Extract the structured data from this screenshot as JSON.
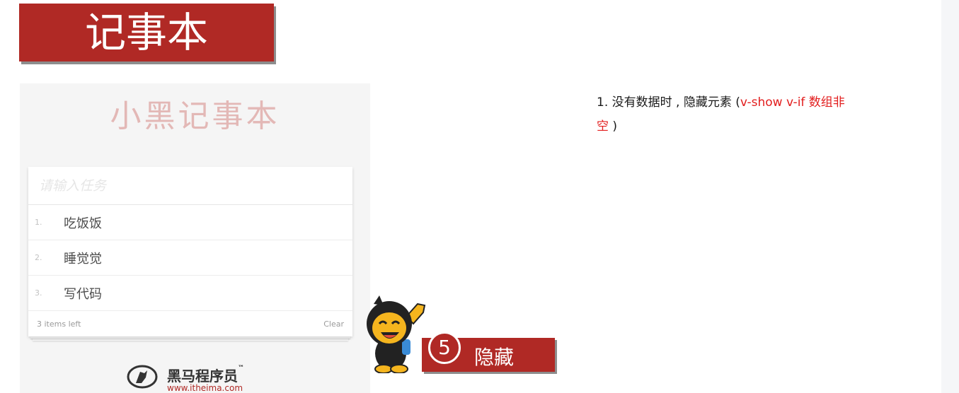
{
  "banner": {
    "title": "记事本"
  },
  "app": {
    "heading": "小黑记事本",
    "input_placeholder": "请输入任务",
    "todos": [
      {
        "index": "1.",
        "text": "吃饭饭"
      },
      {
        "index": "2.",
        "text": "睡觉觉"
      },
      {
        "index": "3.",
        "text": "写代码"
      }
    ],
    "footer": {
      "count_text": "3 items left",
      "clear_label": "Clear"
    },
    "brand": {
      "name": "黑马程序员",
      "tm": "™",
      "url": "www.itheima.com"
    }
  },
  "step": {
    "number": "5",
    "label": "隐藏"
  },
  "note": {
    "prefix": "1.  没有数据时 , 隐藏元素 (",
    "red1": "v-show v-if  数组非",
    "red2": "空",
    "suffix": " )"
  },
  "colors": {
    "accent": "#b02925",
    "highlight": "#e21d1d",
    "app_title": "#e3b8b6"
  }
}
